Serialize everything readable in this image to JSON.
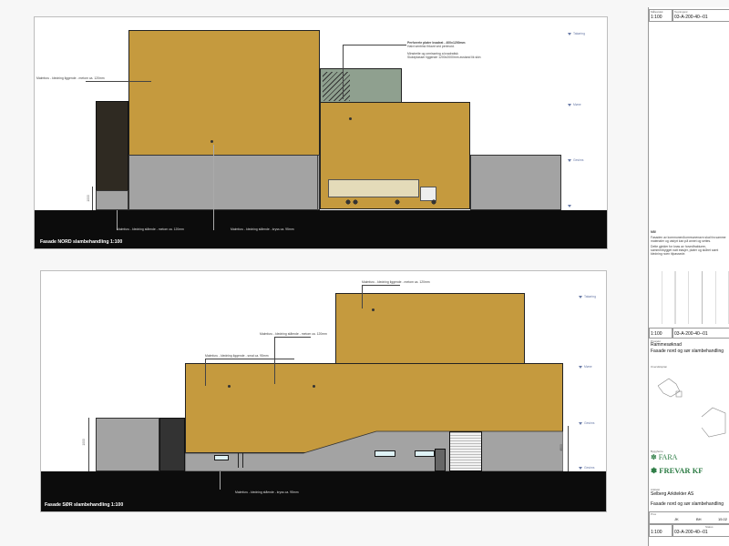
{
  "north": {
    "caption": "Fasade NORD slambehandling    1:100",
    "labels": {
      "left_cladding": "Malmfuru - kledning liggende - metom ca. 120mm",
      "bottom_left": "Malmfuru - kledning stående - metom ca. 120mm",
      "bottom_mid": "Malmfuru - kledning stående - kryss ca. 95mm",
      "perf_title": "Perforerte plater kvadrat - 400x1200mm",
      "perf_line2": "Halvt sentrisk firkant ved perimoid.",
      "perf_line3": "Minstreite og omrisseing a kvadratisk",
      "perf_line4": "Slukeplasser liggende 1200x2000mm avstand lik skin",
      "dim_left": "1000"
    },
    "levels": [
      "Takøring",
      "Møne",
      "Gesims"
    ]
  },
  "south": {
    "caption": "Fasade SØR slambehandling    1:100",
    "labels": {
      "top": "Malmfuru - kledning liggende - metom ca. 120mm",
      "mid": "Malmfuru - kledning stående - metom ca. 120mm",
      "low": "Malmfuru - kledning liggende - smal ca. 95mm",
      "bottom": "Malmfuru - kledning stående - kryss ca. 95mm",
      "dim_left": "1000",
      "dim_right": "4500"
    },
    "levels": [
      "Takøring",
      "Møne",
      "Gesims",
      "Gesims"
    ]
  },
  "titleblock": {
    "top": {
      "scale_label": "Målestokk",
      "scale": "1:100",
      "drawing_no_label": "Tegningsnr.",
      "drawing_no": "03-A-200-40--01"
    },
    "notes_title": "NB!",
    "notes": [
      "Fasaden av kommunen/kommunenavn skal fra samme",
      "materialer og utstyrt kan på annet og settes.",
      "Dette gjelder for knas av hovedfrakturen,",
      "sammenbygget natt etasjer, plater og skåret samt",
      "kledning noen tilpassede."
    ],
    "mid": {
      "scale": "1:100",
      "drawing_no": "03-A-200-40--01",
      "project_label": "Prosjekt",
      "project": "Rammesøknad",
      "title": "Fasade nord og sør slambehandling",
      "keyplan_label": "Oversiktsplan"
    },
    "client_label": "Byggherre",
    "logo1": "FARA",
    "logo2": "FREVAR KF",
    "architect_label": "Arkitekt",
    "architect": "Selberg Arkitekter AS",
    "bottom_title": "Fasade nord og sør slambehandling",
    "bottom": {
      "scale": "1:100",
      "drawing_no": "03-A-200-40--01",
      "small1": "JK",
      "small2": "BH",
      "date": "15.02"
    },
    "prox_label": "Prox",
    "status_label": "Status"
  }
}
